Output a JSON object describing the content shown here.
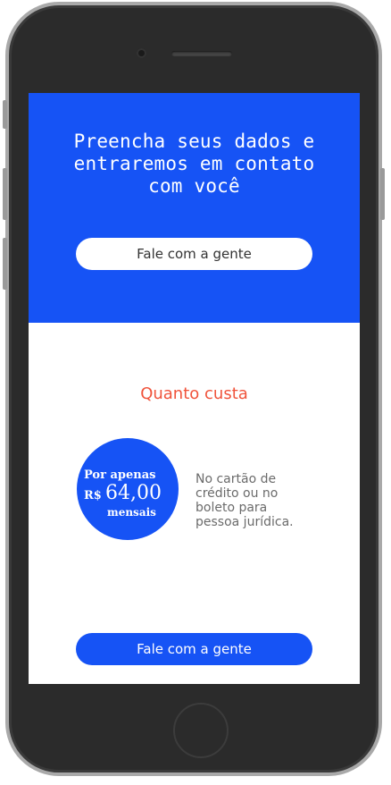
{
  "hero": {
    "title_line1": "Preencha seus dados e",
    "title_line2": "entraremos em contato",
    "title_line3": "com você",
    "cta_label": "Fale com a gente"
  },
  "pricing": {
    "title": "Quanto custa",
    "badge": {
      "line1": "Por apenas",
      "currency": "R$",
      "value": "64,00",
      "line3": "mensais"
    },
    "description": "No cartão de crédito ou no boleto para pessoa jurídica.",
    "cta_label": "Fale com a gente"
  },
  "colors": {
    "brand_blue": "#1653f5",
    "accent_red": "#f0533b"
  }
}
